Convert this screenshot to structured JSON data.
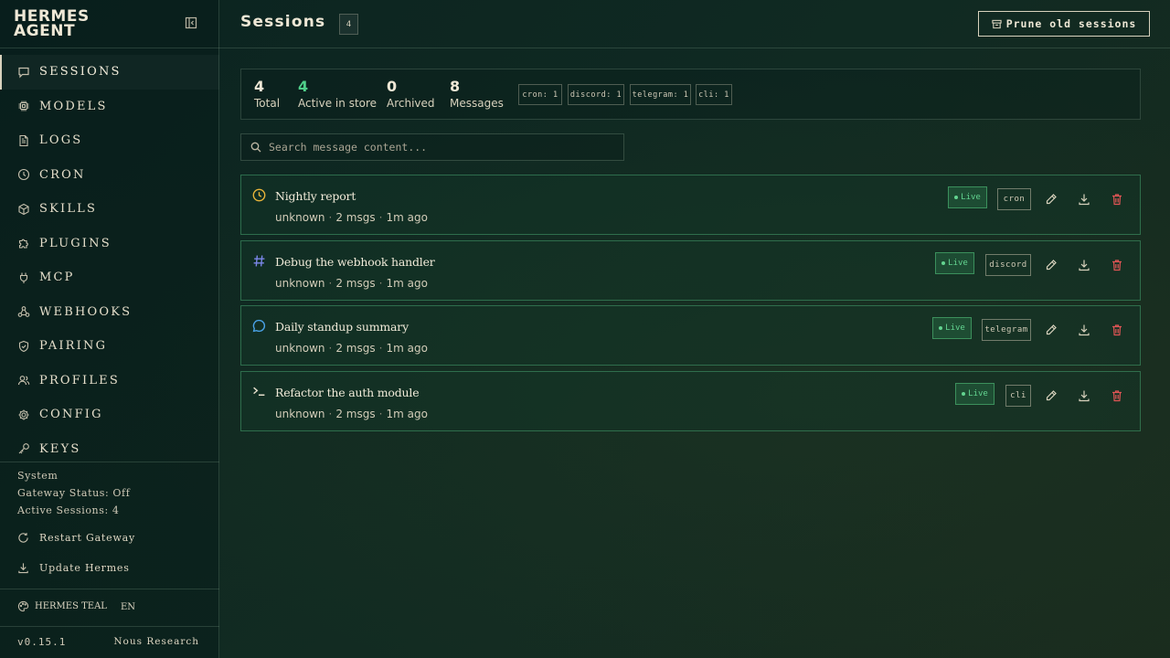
{
  "brand": {
    "line1": "HERMES",
    "line2": "AGENT"
  },
  "sidebar": {
    "items": [
      {
        "label": "SESSIONS",
        "icon": "chat-bubble-icon",
        "active": true
      },
      {
        "label": "MODELS",
        "icon": "chip-icon"
      },
      {
        "label": "LOGS",
        "icon": "document-icon"
      },
      {
        "label": "CRON",
        "icon": "clock-icon"
      },
      {
        "label": "SKILLS",
        "icon": "cube-icon"
      },
      {
        "label": "PLUGINS",
        "icon": "puzzle-icon"
      },
      {
        "label": "MCP",
        "icon": "plug-icon"
      },
      {
        "label": "WEBHOOKS",
        "icon": "webhook-icon"
      },
      {
        "label": "PAIRING",
        "icon": "shield-check-icon"
      },
      {
        "label": "PROFILES",
        "icon": "users-icon"
      },
      {
        "label": "CONFIG",
        "icon": "gear-icon"
      },
      {
        "label": "KEYS",
        "icon": "key-icon"
      }
    ],
    "system": {
      "heading": "System",
      "gateway_status": "Gateway Status: Off",
      "active_sessions": "Active Sessions: 4"
    },
    "actions": {
      "restart": "Restart Gateway",
      "update": "Update Hermes"
    },
    "theme": "HERMES TEAL",
    "language": "EN",
    "version": "v0.15.1",
    "org": "Nous Research"
  },
  "header": {
    "title": "Sessions",
    "count_badge": "4",
    "prune_label": "Prune old sessions"
  },
  "stats": {
    "total": {
      "value": "4",
      "label": "Total"
    },
    "active": {
      "value": "4",
      "label": "Active in store"
    },
    "archived": {
      "value": "0",
      "label": "Archived"
    },
    "messages": {
      "value": "8",
      "label": "Messages"
    },
    "chips": [
      "cron: 1",
      "discord: 1",
      "telegram: 1",
      "cli: 1"
    ]
  },
  "search": {
    "placeholder": "Search message content..."
  },
  "sessions": [
    {
      "title": "Nightly report",
      "model": "unknown",
      "msgs": "2 msgs",
      "time": "1m ago",
      "status": "Live",
      "source": "cron",
      "icon": "clock-icon",
      "icon_color": "#e8b43a"
    },
    {
      "title": "Debug the webhook handler",
      "model": "unknown",
      "msgs": "2 msgs",
      "time": "1m ago",
      "status": "Live",
      "source": "discord",
      "icon": "hash-icon",
      "icon_color": "#7b86e8"
    },
    {
      "title": "Daily standup summary",
      "model": "unknown",
      "msgs": "2 msgs",
      "time": "1m ago",
      "status": "Live",
      "source": "telegram",
      "icon": "chat-bubble-icon",
      "icon_color": "#4aa3e8"
    },
    {
      "title": "Refactor the auth module",
      "model": "unknown",
      "msgs": "2 msgs",
      "time": "1m ago",
      "status": "Live",
      "source": "cli",
      "icon": "terminal-icon",
      "icon_color": "#e6dfcb"
    }
  ],
  "colors": {
    "accent_green": "#4fd08a",
    "delete_red": "#e05555",
    "text": "#efe8d6"
  }
}
